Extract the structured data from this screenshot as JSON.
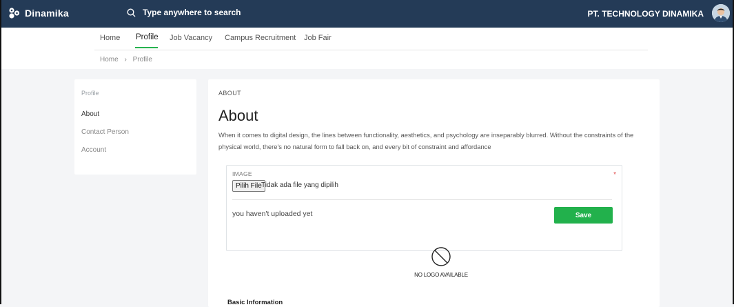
{
  "topbar": {
    "logo_text": "Dinamika",
    "search_placeholder": "Type anywhere to search",
    "company": "PT. TECHNOLOGY DINAMIKA"
  },
  "nav": {
    "items": [
      "Home",
      "Profile",
      "Job Vacancy",
      "Campus Recruitment",
      "Job Fair"
    ],
    "active": "Profile"
  },
  "breadcrumb": {
    "home": "Home",
    "separator": "›",
    "current": "Profile"
  },
  "sidebar": {
    "section": "Profile",
    "items": [
      "About",
      "Contact Person",
      "Account"
    ],
    "active": "About"
  },
  "main": {
    "section_label": "ABOUT",
    "title": "About",
    "description": "When it comes to digital design, the lines between functionality, aesthetics, and psychology are inseparably blurred. Without the constraints of the physical world, there's no natural form to fall back on, and every bit of constraint and affordance",
    "image": {
      "label": "IMAGE",
      "required_mark": "*",
      "file_button": "Pilih File",
      "file_status": "Tidak ada file yang dipilih",
      "upload_status": "you haven't uploaded yet",
      "save_label": "Save"
    },
    "no_logo_text": "NO LOGO AVAILABLE",
    "basic_info_title": "Basic Information"
  },
  "colors": {
    "topbar": "#243b57",
    "accent_green": "#22b14c",
    "background": "#f4f5f7"
  },
  "icons": {
    "logo": "dinamika-logo-icon",
    "search": "search-icon",
    "avatar": "avatar",
    "no_logo": "no-symbol-icon"
  }
}
